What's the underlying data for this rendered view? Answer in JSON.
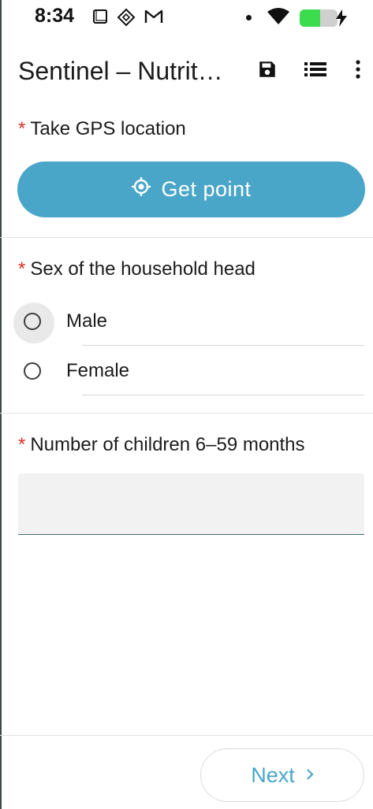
{
  "status_bar": {
    "time": "8:34",
    "icons": [
      "square-notification-icon",
      "network-diamond-icon",
      "gmail-icon",
      "notification-dot",
      "wifi-icon",
      "battery-charging-icon"
    ],
    "battery_color": "#3ddc4e"
  },
  "app_bar": {
    "title": "Sentinel – Nutrit…",
    "actions": [
      "save-icon",
      "list-icon",
      "more-vert-icon"
    ]
  },
  "form": {
    "required_marker": "*",
    "gps": {
      "label": "Take GPS location",
      "button_label": "Get point"
    },
    "sex": {
      "label": "Sex of the household head",
      "options": [
        "Male",
        "Female"
      ],
      "selected": null
    },
    "children": {
      "label": "Number of children 6–59 months",
      "value": "",
      "placeholder": ""
    }
  },
  "footer": {
    "next_label": "Next"
  },
  "colors": {
    "accent": "#4aa6c8",
    "required": "#d93025",
    "input_underline": "#3b6f73"
  }
}
